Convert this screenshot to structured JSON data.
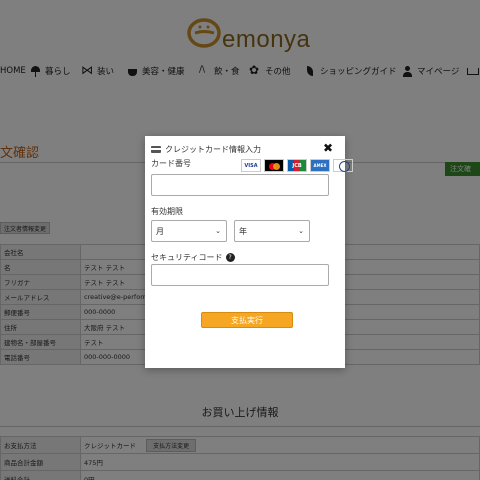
{
  "brand": {
    "logo_text": "emonya"
  },
  "nav": [
    {
      "label": "HOME",
      "icon": ""
    },
    {
      "label": "暮らし",
      "icon": "lamp-icon"
    },
    {
      "label": "装い",
      "icon": "bow-icon"
    },
    {
      "label": "美容・健康",
      "icon": "pot-icon"
    },
    {
      "label": "飲・食",
      "icon": "chopsticks-icon"
    },
    {
      "label": "その他",
      "icon": "flower-icon"
    },
    {
      "label": "ショッピングガイド",
      "icon": "leaf-icon"
    },
    {
      "label": "マイページ",
      "icon": "user-icon"
    },
    {
      "label": "",
      "icon": "cart-icon"
    }
  ],
  "page": {
    "section_title": "文確認",
    "order_button": "注文確",
    "change_info_button": "注文者情報変更",
    "info_rows": [
      {
        "key": "会社名",
        "value": ""
      },
      {
        "key": "名",
        "value": "テスト テスト"
      },
      {
        "key": "フリガナ",
        "value": "テスト テスト"
      },
      {
        "key": "メールアドレス",
        "value": "creative@e-perform"
      },
      {
        "key": "郵便番号",
        "value": "000-0000"
      },
      {
        "key": "住所",
        "value": "大阪府 テスト"
      },
      {
        "key": "建物名・部屋番号",
        "value": "テスト"
      },
      {
        "key": "電話番号",
        "value": "000-000-0000"
      }
    ],
    "bought_title": "お買い上げ情報",
    "pay_rows": [
      {
        "key": "お支払方法",
        "value": "クレジットカード",
        "button": "支払方法変更"
      },
      {
        "key": "商品合計金額",
        "value": "475円",
        "button": ""
      },
      {
        "key": "送料合計",
        "value": "0円",
        "button": ""
      }
    ]
  },
  "modal": {
    "title": "クレジットカード情報入力",
    "card_number_label": "カード番号",
    "card_number_value": "",
    "brands": [
      "VISA",
      "MasterCard",
      "JCB",
      "AMEX",
      "Diners Club"
    ],
    "expiry_label": "有効期限",
    "month_value": "月",
    "year_value": "年",
    "cvc_label": "セキュリティコード",
    "cvc_value": "",
    "submit_label": "支払実行"
  }
}
